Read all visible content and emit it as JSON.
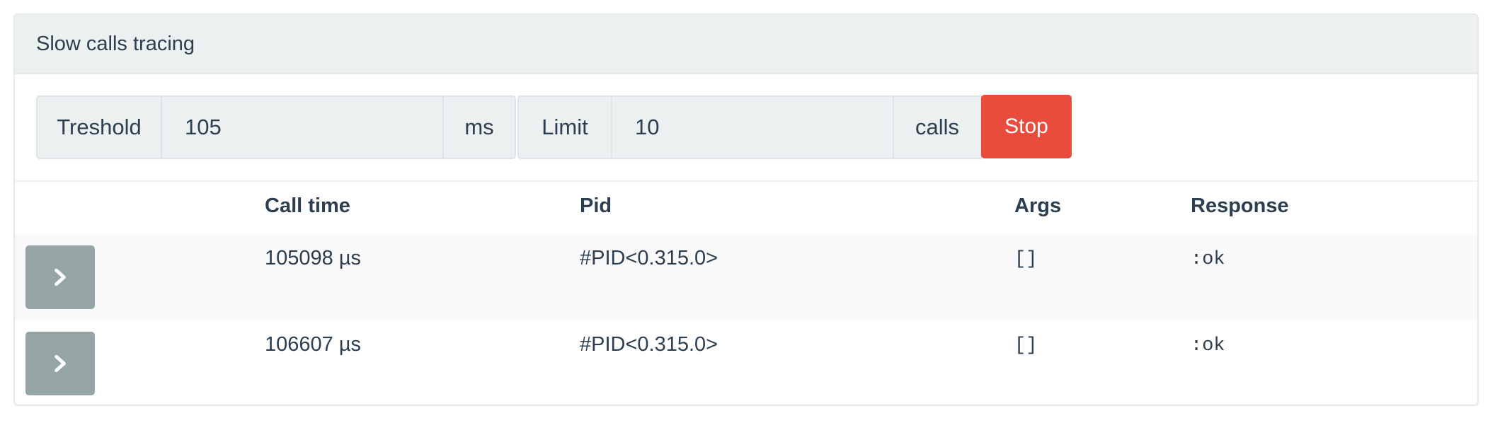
{
  "panel": {
    "title": "Slow calls tracing"
  },
  "controls": {
    "threshold_label": "Treshold",
    "threshold_value": "105",
    "threshold_unit": "ms",
    "limit_label": "Limit",
    "limit_value": "10",
    "limit_unit": "calls",
    "stop_label": "Stop"
  },
  "table": {
    "columns": [
      "Call time",
      "Pid",
      "Args",
      "Response"
    ],
    "rows": [
      {
        "call_time": "105098 µs",
        "pid": "#PID<0.315.0>",
        "args": "[]",
        "response": ":ok"
      },
      {
        "call_time": "106607 µs",
        "pid": "#PID<0.315.0>",
        "args": "[]",
        "response": ":ok"
      }
    ]
  },
  "icons": {
    "expand": "chevron-right-icon"
  },
  "colors": {
    "heading_bg": "#ecf0f1",
    "stop_button": "#e74c3c",
    "expand_button": "#95a5a6",
    "text": "#2c3e50"
  }
}
